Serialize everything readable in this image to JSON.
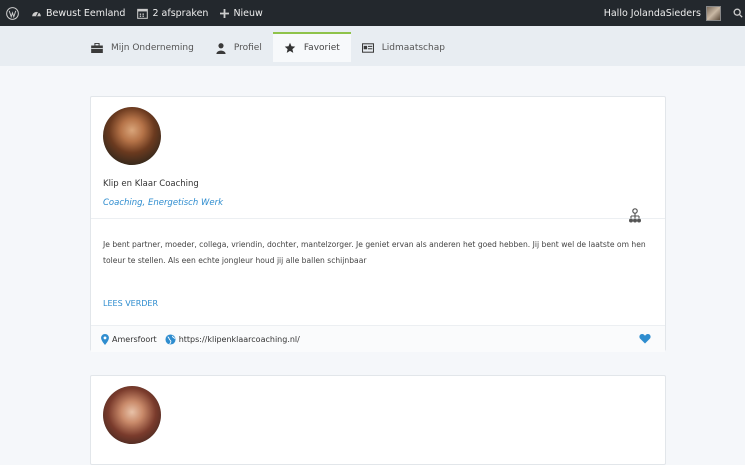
{
  "adminbar": {
    "site_name": "Bewust Eemland",
    "appointments": "2 afspraken",
    "new_label": "Nieuw",
    "greeting": "Hallo JolandaSieders"
  },
  "tabs": [
    {
      "label": "Mijn Onderneming",
      "icon": "briefcase-icon"
    },
    {
      "label": "Profiel",
      "icon": "user-icon"
    },
    {
      "label": "Favoriet",
      "icon": "star-icon",
      "active": true
    },
    {
      "label": "Lidmaatschap",
      "icon": "id-card-icon"
    }
  ],
  "listings": [
    {
      "name": "Klip en Klaar Coaching",
      "categories": "Coaching, Energetisch Werk",
      "description": "Je bent partner, moeder, collega, vriendin, dochter, mantelzorger. Je geniet ervan als anderen het goed hebben. Jij bent wel de laatste om hen toleur te stellen. Als een echte jongleur houd jij alle ballen schijnbaar",
      "read_more": "LEES VERDER",
      "location": "Amersfoort",
      "website": "https://klipenklaarcoaching.nl/"
    }
  ],
  "colors": {
    "accent": "#2f8dcf",
    "admin_bar": "#23282d",
    "tab_active_border": "#8fc34a"
  }
}
